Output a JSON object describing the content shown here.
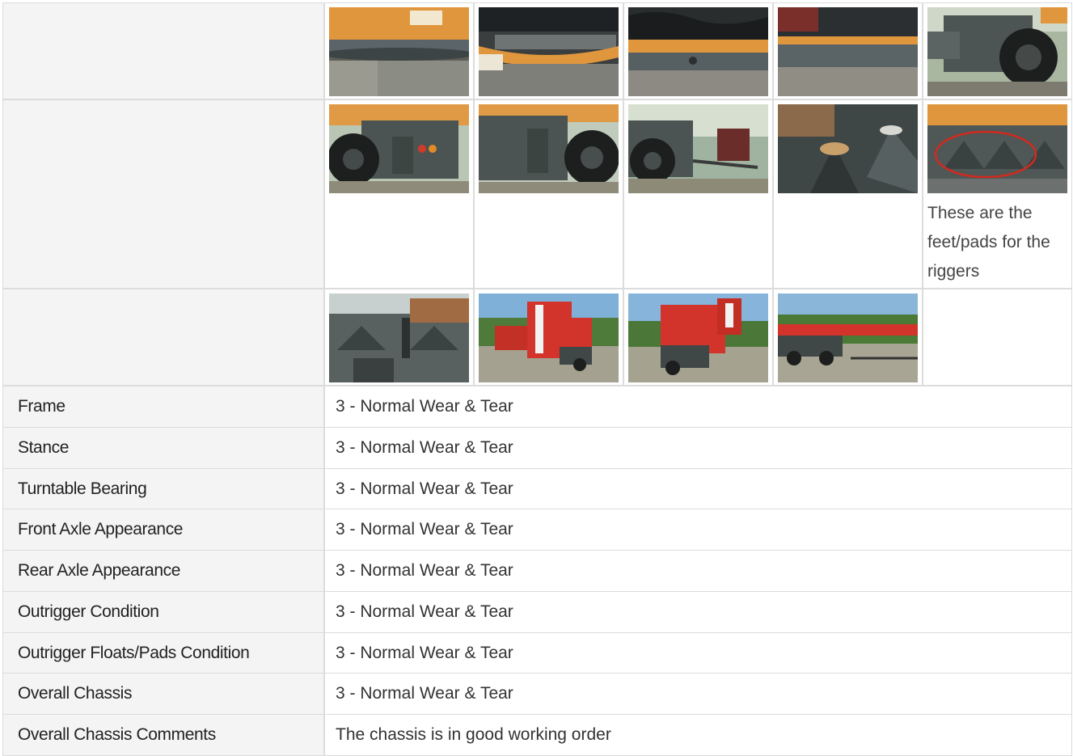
{
  "photo_rows": [
    {
      "photos": [
        {
          "name": "turntable-bearing-photo-1",
          "scene": "bearing1"
        },
        {
          "name": "turntable-bearing-photo-2",
          "scene": "bearing2"
        },
        {
          "name": "turntable-bearing-photo-3",
          "scene": "bearing3"
        },
        {
          "name": "turntable-bearing-photo-4",
          "scene": "bearing4"
        },
        {
          "name": "chassis-rear-wheel-photo",
          "scene": "wheelSide"
        }
      ]
    },
    {
      "photos": [
        {
          "name": "chassis-rear-lights-photo",
          "scene": "rearLights"
        },
        {
          "name": "chassis-rear-tire-photo",
          "scene": "rearTire"
        },
        {
          "name": "chassis-rear-hitch-photo",
          "scene": "rearHitch"
        },
        {
          "name": "outrigger-pads-photo-1",
          "scene": "pads1"
        },
        {
          "name": "outrigger-pads-photo-2",
          "scene": "pads2",
          "caption": "These are the feet/pads for the riggers"
        }
      ]
    },
    {
      "photos": [
        {
          "name": "outrigger-pads-photo-3",
          "scene": "pads3"
        },
        {
          "name": "crane-front-view-photo",
          "scene": "craneFront1"
        },
        {
          "name": "crane-rear-view-photo",
          "scene": "craneFront2"
        },
        {
          "name": "crane-side-view-photo",
          "scene": "craneSide"
        }
      ]
    }
  ],
  "ratings": [
    {
      "label": "Frame",
      "value": "3 - Normal Wear & Tear"
    },
    {
      "label": "Stance",
      "value": "3 - Normal Wear & Tear"
    },
    {
      "label": "Turntable Bearing",
      "value": "3 - Normal Wear & Tear"
    },
    {
      "label": "Front Axle Appearance",
      "value": "3 - Normal Wear & Tear"
    },
    {
      "label": "Rear Axle Appearance",
      "value": "3 - Normal Wear & Tear"
    },
    {
      "label": "Outrigger Condition",
      "value": "3 - Normal Wear & Tear"
    },
    {
      "label": "Outrigger Floats/Pads Condition",
      "value": "3 - Normal Wear & Tear"
    },
    {
      "label": "Overall Chassis",
      "value": "3 - Normal Wear & Tear"
    },
    {
      "label": "Overall Chassis Comments",
      "value": "The chassis is in good working order"
    }
  ],
  "colors": {
    "label_background": "#f4f4f4",
    "cell_border": "#dcdcdc",
    "crane_orange": "#e39a3a",
    "crane_red": "#d2332a",
    "chassis_grey": "#4a5150"
  }
}
